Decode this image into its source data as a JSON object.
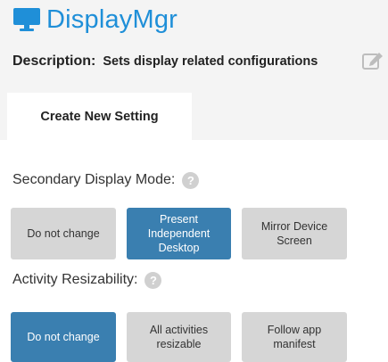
{
  "app": {
    "title": "DisplayMgr",
    "icon": "monitor-icon",
    "accent_color": "#1f8fd8"
  },
  "description": {
    "label": "Description:",
    "value": "Sets display related configurations",
    "edit_icon": "edit-icon"
  },
  "tabs": [
    {
      "label": "Create New Setting",
      "active": true
    }
  ],
  "secondary_display_mode": {
    "title": "Secondary Display Mode:",
    "help_icon": "?",
    "options": [
      {
        "label": "Do not change",
        "selected": false
      },
      {
        "label": "Present Independent Desktop",
        "selected": true
      },
      {
        "label": "Mirror Device Screen",
        "selected": false
      }
    ]
  },
  "activity_resizability": {
    "title": "Activity Resizability:",
    "help_icon": "?",
    "options": [
      {
        "label": "Do not change",
        "selected": true
      },
      {
        "label": "All activities resizable",
        "selected": false
      },
      {
        "label": "Follow app manifest",
        "selected": false
      }
    ]
  },
  "colors": {
    "selected": "#3a7fb0",
    "unselected": "#d6d6d6",
    "header_background": "#f4f4f4"
  }
}
